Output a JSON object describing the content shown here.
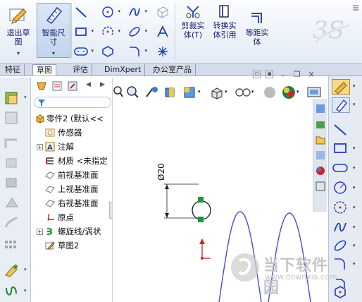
{
  "ribbon": {
    "exit_sketch_label": "退出草\n图",
    "smart_dimension_label": "智能尺\n寸",
    "trim_label": "剪裁实\n体(T)",
    "convert_label": "转换实\n体引用",
    "offset_label": "等距实\n体"
  },
  "tabs": [
    "特征",
    "草图",
    "评估",
    "DimXpert",
    "办公室产品"
  ],
  "active_tab": "草图",
  "tree": {
    "part": "零件2 (默认<<",
    "sensors": "传感器",
    "annotations": "注解",
    "material": "材质 <未指定",
    "front_plane": "前视基准面",
    "top_plane": "上视基准面",
    "right_plane": "右视基准面",
    "origin": "原点",
    "helix": "螺旋线/涡状",
    "sketch2": "草图2"
  },
  "canvas": {
    "dimension_text": "Ø20"
  },
  "watermark": {
    "title": "当下软件园",
    "url": "www.downxia.com"
  },
  "colors": {
    "accent_blue": "#1f3fbf",
    "sketch_blue": "#4a4ad6",
    "highlight_green": "#0f9c3a",
    "origin_red": "#d4202a"
  }
}
